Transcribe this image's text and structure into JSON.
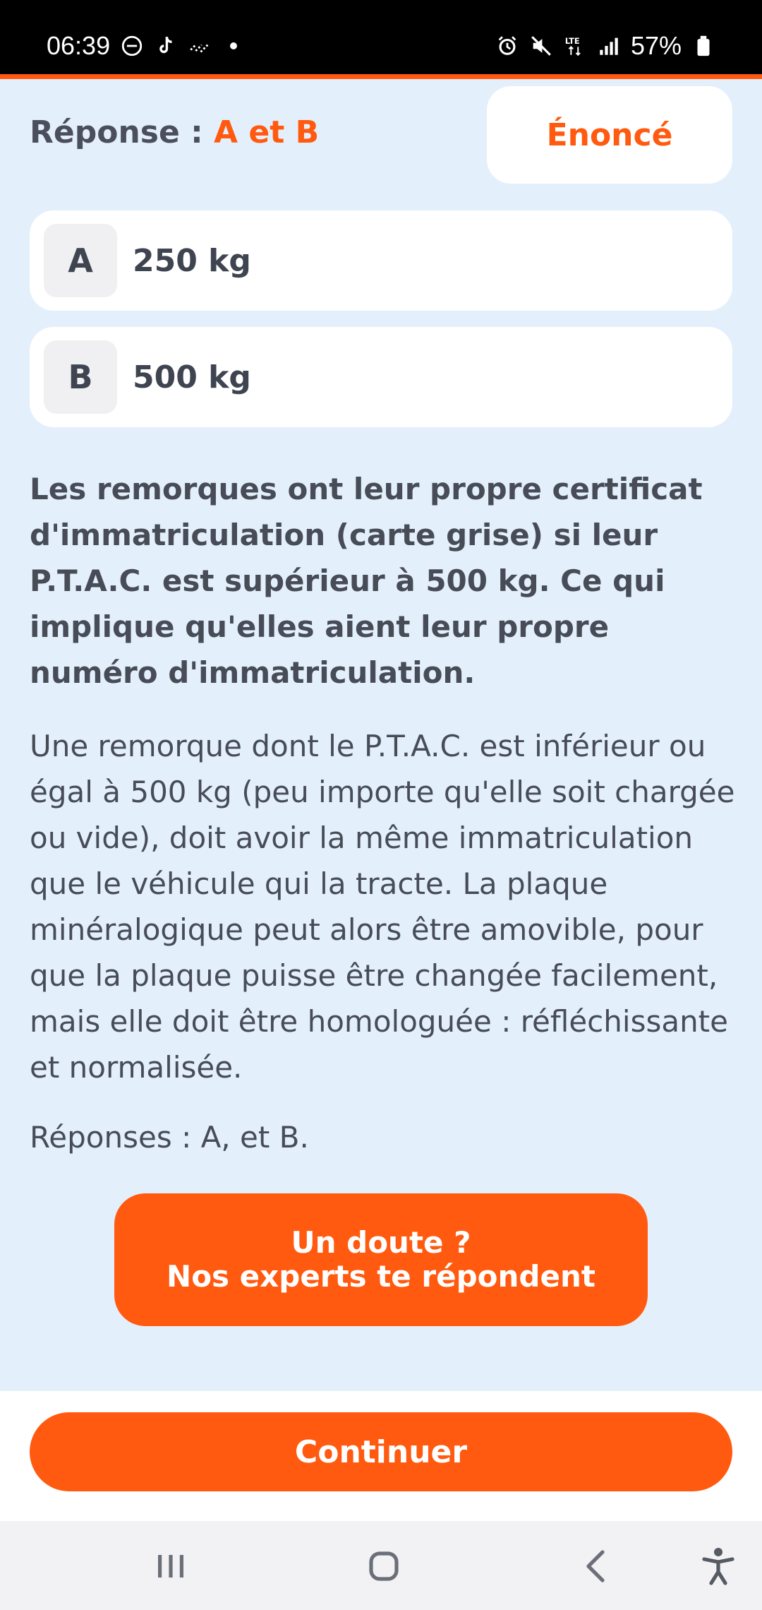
{
  "status_bar": {
    "time": "06:39",
    "battery": "57%",
    "network": "LTE",
    "icons": [
      "do-not-disturb-icon",
      "tiktok-icon",
      "signal-dots-icon",
      "dot-icon",
      "alarm-icon",
      "mute-icon",
      "lte-icon",
      "signal-bars-icon",
      "battery-icon"
    ]
  },
  "header": {
    "reponse_label": "Réponse : ",
    "reponse_value": "A et B",
    "enonce_button": "Énoncé"
  },
  "answers": [
    {
      "letter": "A",
      "value": "250 kg"
    },
    {
      "letter": "B",
      "value": "500 kg"
    }
  ],
  "explanation": {
    "bold": "Les remorques ont leur propre certificat d'immatriculation (carte grise) si leur P.T.A.C. est supérieur à 500 kg. Ce qui implique qu'elles aient leur propre numéro d'immatriculation.",
    "normal": "Une remorque dont le P.T.A.C. est inférieur ou égal à 500 kg (peu importe qu'elle soit chargée ou vide), doit avoir la même immatriculation que le véhicule qui la tracte. La plaque minéralogique peut alors être amovible, pour que la plaque puisse être changée facilement, mais elle doit être homologuée : réfléchissante et normalisée.",
    "summary": "Réponses : A, et B."
  },
  "expert_button": {
    "line1": "Un doute ?",
    "line2": "Nos experts te répondent"
  },
  "continue_button": "Continuer",
  "nav_bar": {
    "icons": [
      "recent-apps-icon",
      "home-icon",
      "back-icon",
      "accessibility-icon"
    ]
  },
  "colors": {
    "accent": "#ff5a0f",
    "background": "#e3f0fc",
    "text": "#474c57"
  }
}
